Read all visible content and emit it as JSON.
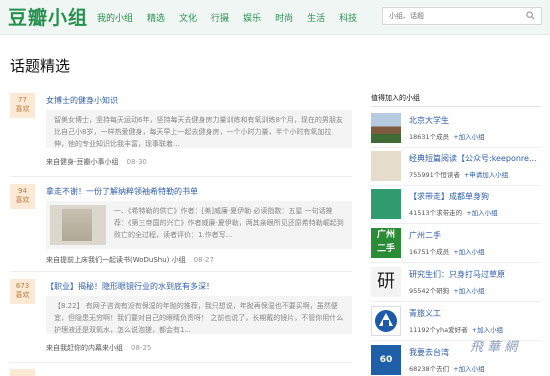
{
  "header": {
    "logo": "豆瓣小组",
    "nav": [
      "我的小组",
      "精选",
      "文化",
      "行摄",
      "娱乐",
      "时尚",
      "生活",
      "科技"
    ],
    "search_placeholder": "小组、话题"
  },
  "page_title": "话题精选",
  "topics": [
    {
      "likes": "77",
      "like_label": "喜欢",
      "title": "女博士的健身小知识",
      "excerpt": "留美女博士，坚持每天运动6年，坚持每天去健身房力量训练和有氧训练8个月，现在的男朋友比自己小8岁，一样热爱健身，每天早上一起去健身房，一个小时力量，半个小时有氧加拉伸，他的专业知识比我丰富，现事联着...",
      "source": "来自健身-豆瓣小事小组",
      "date": "08-30"
    },
    {
      "likes": "94",
      "like_label": "喜欢",
      "title": "拿走不谢！一份了解纳粹领袖希特勒的书单",
      "excerpt": "一、《希特勒的供亡》作者：[美]威廉·夏伊勒 必读指数：五星 一句话推荐：《第三帝国的兴亡》作者威廉·夏伊勒，两其亲眼所见还原希特勒崛起到败亡的全过程，读者评价：1.作者写...",
      "source": "来自提前上床我们一起读书(WoDuShu) 小组",
      "date": "08-27"
    },
    {
      "likes": "673",
      "like_label": "喜欢",
      "title": "【职业】揭秘！隐形眼镜行业的水到底有多深！",
      "excerpt": "【8.22】 有网子咨询有没有保湿的年抛的推荐，我只想说，年抛再保湿也不要买啊，虽然便宜，但隐患无穷啊！我们要对自己的眼睛负责呀！ 之前也说了，长期戴的镜片，不管你用什么护理液还是双氧水，怎么说泡搓，都会有1...",
      "source": "来自我赶你的内幕来小组",
      "date": "08-25"
    }
  ],
  "sidebar": {
    "title": "值得加入的小组",
    "groups": [
      {
        "name": "北京大学生",
        "members": "18631个成员",
        "join": "+加入小组"
      },
      {
        "name": "经典短篇阅读【公众号:keeponre...",
        "members": "755991个恒读者",
        "join": "+申请加入小组"
      },
      {
        "name": "【求带走】成都单身狗",
        "members": "41513个求带走的",
        "join": "+加入小组"
      },
      {
        "name": "广州二手",
        "members": "16751个成员",
        "join": "+加入小组"
      },
      {
        "name": "研究生们：只身打马过草原",
        "members": "95542个研狗",
        "join": "+加入小组"
      },
      {
        "name": "青旅义工",
        "members": "11192个yha爱好者",
        "join": "+加入小组"
      },
      {
        "name": "我要去台湾",
        "members": "68238个去们",
        "join": "+加入小组"
      }
    ]
  },
  "colors": {
    "brand": "#27924f",
    "link": "#2c5ea8",
    "like_bg": "#fbe9d6"
  }
}
